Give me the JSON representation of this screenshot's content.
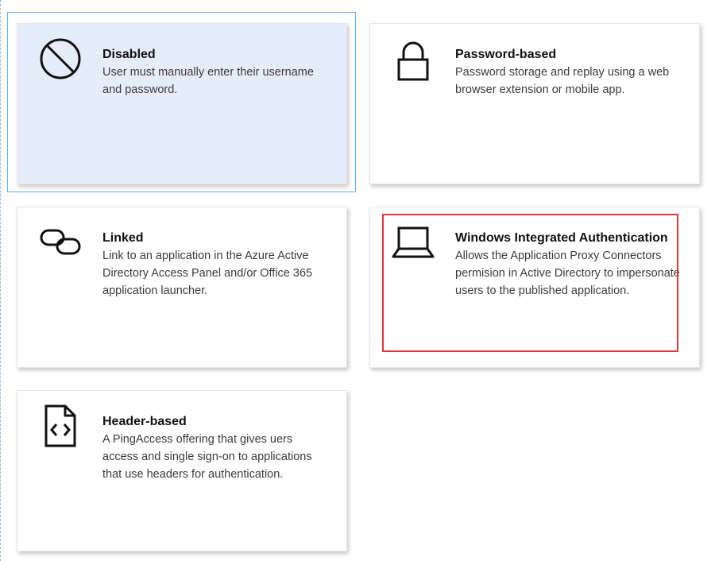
{
  "sso_methods": [
    {
      "id": "disabled",
      "title": "Disabled",
      "description": "User must manually enter their username and password.",
      "icon": "disabled-icon",
      "selected": true
    },
    {
      "id": "password",
      "title": "Password-based",
      "description": "Password storage and replay using a web browser extension or mobile app.",
      "icon": "lock-icon",
      "selected": false
    },
    {
      "id": "linked",
      "title": "Linked",
      "description": "Link to an application in the Azure Active Directory Access Panel and/or Office 365 application launcher.",
      "icon": "link-icon",
      "selected": false
    },
    {
      "id": "wia",
      "title": "Windows Integrated Authentication",
      "description": "Allows the Application Proxy Connectors permision in Active Directory to impersonate users to the published application.",
      "icon": "laptop-icon",
      "selected": false,
      "highlighted": true
    },
    {
      "id": "header",
      "title": "Header-based",
      "description": "A PingAccess offering that gives uers access and single sign-on to applications that use headers for authentication.",
      "icon": "code-file-icon",
      "selected": false
    }
  ],
  "colors": {
    "selected_background": "#e6edfa",
    "selected_outline": "#6aaeea",
    "highlight_outline": "#e0363c"
  }
}
